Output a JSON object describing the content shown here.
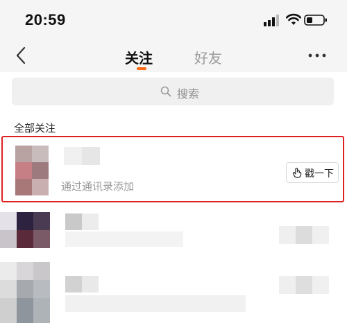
{
  "status_bar": {
    "time": "20:59"
  },
  "nav": {
    "tabs": [
      {
        "label": "关注",
        "active": true
      },
      {
        "label": "好友",
        "active": false
      }
    ],
    "accent_color": "#ff6a13"
  },
  "search": {
    "placeholder": "搜索"
  },
  "section": {
    "title": "全部关注"
  },
  "contact_row": {
    "subtitle": "通过通讯录添加",
    "action_label": "戳一下",
    "highlight_color": "#e02020"
  },
  "icons": [
    "back-icon",
    "more-icon",
    "search-icon",
    "hand-icon",
    "signal-icon",
    "wifi-icon",
    "battery-icon"
  ]
}
